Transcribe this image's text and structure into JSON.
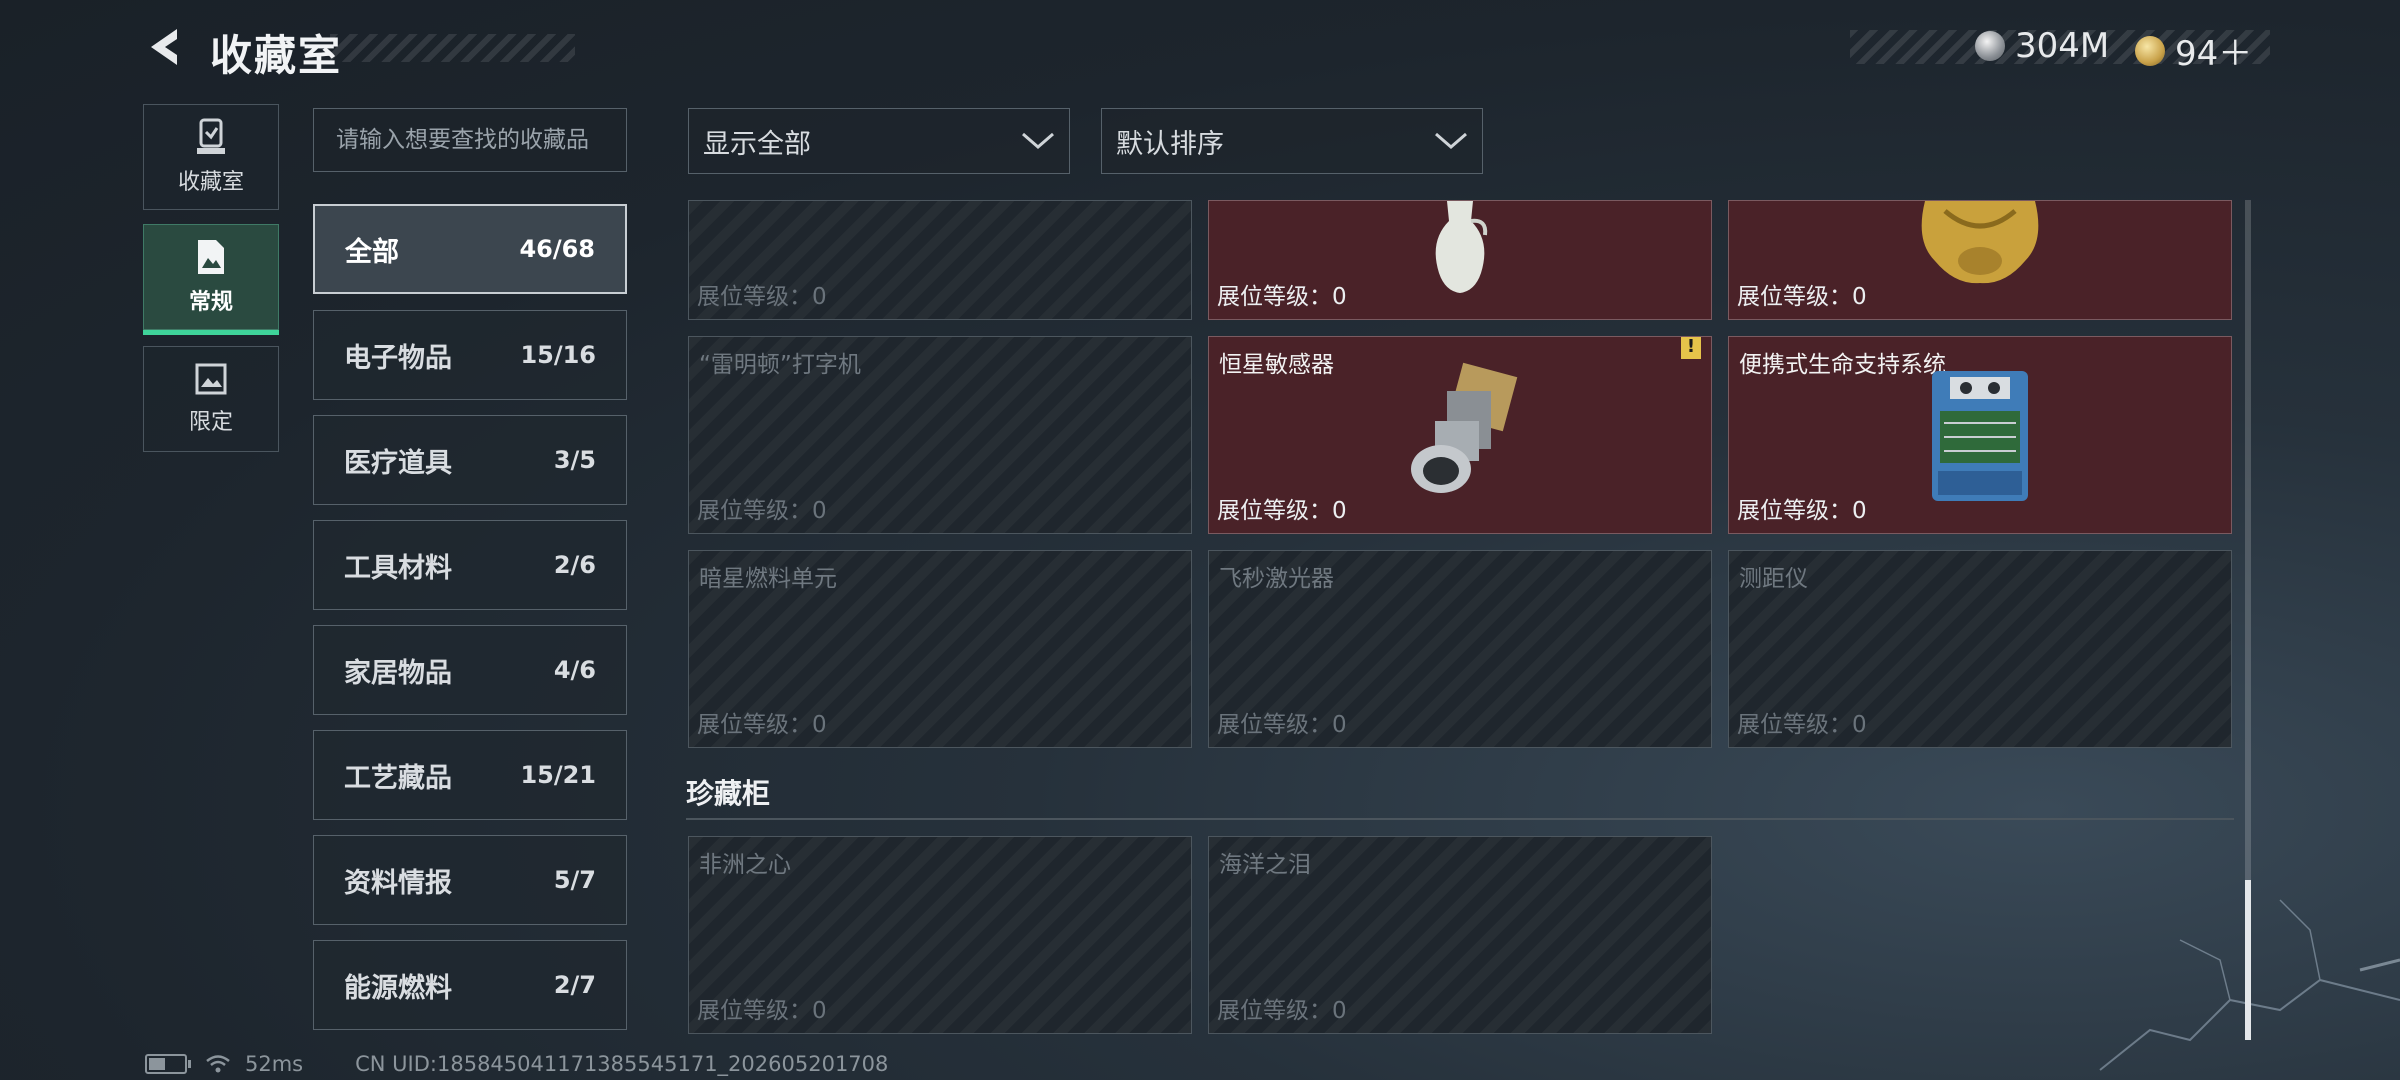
{
  "header": {
    "title": "收藏室"
  },
  "currency": [
    {
      "icon": "silver-coin-icon",
      "value": "304M"
    },
    {
      "icon": "gold-triangle-coin-icon",
      "value": "94＋"
    }
  ],
  "mode_tabs": [
    {
      "label": "收藏室",
      "icon": "trophy-icon",
      "active": false
    },
    {
      "label": "常规",
      "icon": "document-icon",
      "active": true
    },
    {
      "label": "限定",
      "icon": "picture-icon",
      "active": false
    }
  ],
  "search": {
    "placeholder": "请输入想要查找的收藏品"
  },
  "categories": [
    {
      "name": "全部",
      "count": "46/68",
      "active": true
    },
    {
      "name": "电子物品",
      "count": "15/16"
    },
    {
      "name": "医疗道具",
      "count": "3/5"
    },
    {
      "name": "工具材料",
      "count": "2/6"
    },
    {
      "name": "家居物品",
      "count": "4/6"
    },
    {
      "name": "工艺藏品",
      "count": "15/21"
    },
    {
      "name": "资料情报",
      "count": "5/7"
    },
    {
      "name": "能源燃料",
      "count": "2/7"
    }
  ],
  "filters": {
    "display": "显示全部",
    "sort": "默认排序"
  },
  "items": [
    {
      "name": "",
      "level": "展位等级：0",
      "owned": false
    },
    {
      "name": "",
      "level": "展位等级：0",
      "owned": true,
      "art": "vase"
    },
    {
      "name": "",
      "level": "展位等级：0",
      "owned": true,
      "art": "gold-statue"
    },
    {
      "name": "“雷明顿”打字机",
      "level": "展位等级：0",
      "owned": false
    },
    {
      "name": "恒星敏感器",
      "level": "展位等级：0",
      "owned": true,
      "art": "sensor",
      "warning": "!"
    },
    {
      "name": "便携式生命支持系统",
      "level": "展位等级：0",
      "owned": true,
      "art": "life-support"
    },
    {
      "name": "暗星燃料单元",
      "level": "展位等级：0",
      "owned": false
    },
    {
      "name": "飞秒激光器",
      "level": "展位等级：0",
      "owned": false
    },
    {
      "name": "测距仪",
      "level": "展位等级：0",
      "owned": false
    }
  ],
  "section": {
    "title": "珍藏柜"
  },
  "treasures": [
    {
      "name": "非洲之心",
      "level": "展位等级：0",
      "owned": false
    },
    {
      "name": "海洋之泪",
      "level": "展位等级：0",
      "owned": false
    }
  ],
  "status": {
    "latency": "52ms",
    "uid": "CN UID:1858450411713855451​71_202605201708"
  }
}
